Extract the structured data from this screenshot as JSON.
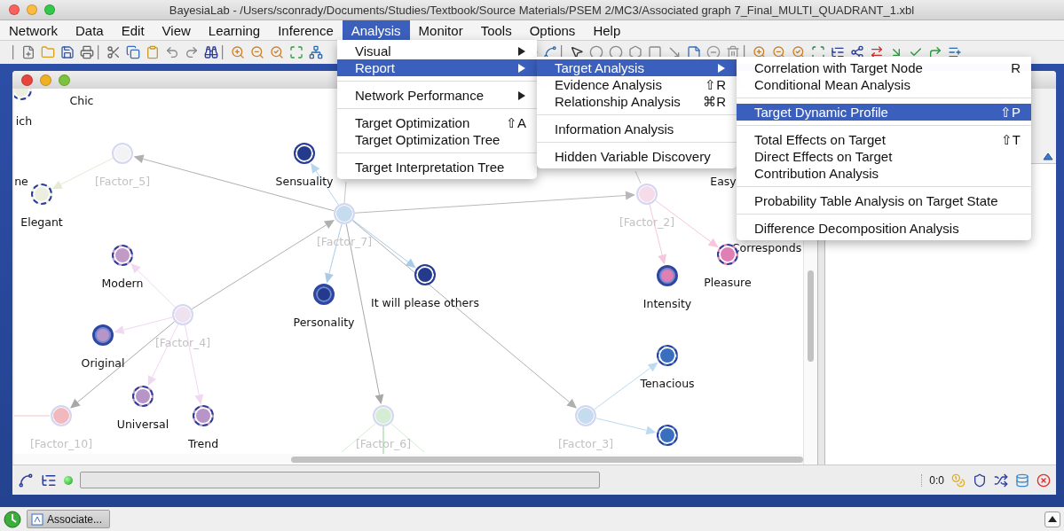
{
  "window": {
    "title": "BayesiaLab - /Users/sconrady/Documents/Studies/Textbook/Source Materials/PSEM 2/MC3/Associated graph 7_Final_MULTI_QUADRANT_1.xbl"
  },
  "menubar": [
    {
      "label": "Network",
      "selected": false
    },
    {
      "label": "Data",
      "selected": false
    },
    {
      "label": "Edit",
      "selected": false
    },
    {
      "label": "View",
      "selected": false
    },
    {
      "label": "Learning",
      "selected": false
    },
    {
      "label": "Inference",
      "selected": false
    },
    {
      "label": "Analysis",
      "selected": true
    },
    {
      "label": "Monitor",
      "selected": false
    },
    {
      "label": "Tools",
      "selected": false
    },
    {
      "label": "Options",
      "selected": false
    },
    {
      "label": "Help",
      "selected": false
    }
  ],
  "menus": [
    {
      "items": [
        {
          "kind": "item",
          "label": "Visual",
          "submenu": true,
          "selected": false
        },
        {
          "kind": "item",
          "label": "Report",
          "submenu": true,
          "selected": true
        },
        {
          "kind": "separator"
        },
        {
          "kind": "item",
          "label": "Network Performance",
          "submenu": true,
          "selected": false
        },
        {
          "kind": "separator"
        },
        {
          "kind": "item",
          "label": "Target Optimization",
          "shortcut": "⇧A",
          "submenu": false,
          "selected": false
        },
        {
          "kind": "item",
          "label": "Target Optimization Tree",
          "submenu": false,
          "selected": false
        },
        {
          "kind": "separator"
        },
        {
          "kind": "item",
          "label": "Target Interpretation Tree",
          "submenu": false,
          "selected": false
        }
      ]
    },
    {
      "items": [
        {
          "kind": "item",
          "label": "Target Analysis",
          "submenu": true,
          "selected": true
        },
        {
          "kind": "item",
          "label": "Evidence Analysis",
          "shortcut": "⇧R",
          "submenu": false,
          "selected": false
        },
        {
          "kind": "item",
          "label": "Relationship Analysis",
          "shortcut": "⌘R",
          "submenu": false,
          "selected": false
        },
        {
          "kind": "separator"
        },
        {
          "kind": "item",
          "label": "Information Analysis",
          "submenu": false,
          "selected": false
        },
        {
          "kind": "separator"
        },
        {
          "kind": "item",
          "label": "Hidden Variable Discovery",
          "submenu": false,
          "selected": false
        }
      ]
    },
    {
      "items": [
        {
          "kind": "item",
          "label": "Correlation with Target Node",
          "shortcut": "R",
          "submenu": false,
          "selected": false
        },
        {
          "kind": "item",
          "label": "Conditional Mean Analysis",
          "submenu": false,
          "selected": false
        },
        {
          "kind": "separator"
        },
        {
          "kind": "item",
          "label": "Target Dynamic Profile",
          "shortcut": "⇧P",
          "submenu": false,
          "selected": true
        },
        {
          "kind": "separator"
        },
        {
          "kind": "item",
          "label": "Total Effects on Target",
          "shortcut": "⇧T",
          "submenu": false,
          "selected": false
        },
        {
          "kind": "item",
          "label": "Direct Effects on Target",
          "submenu": false,
          "selected": false
        },
        {
          "kind": "item",
          "label": "Contribution Analysis",
          "submenu": false,
          "selected": false
        },
        {
          "kind": "separator"
        },
        {
          "kind": "item",
          "label": "Probability Table Analysis on Target State",
          "submenu": false,
          "selected": false
        },
        {
          "kind": "separator"
        },
        {
          "kind": "item",
          "label": "Difference Decomposition Analysis",
          "submenu": false,
          "selected": false
        }
      ]
    }
  ],
  "graph": {
    "nodes": [
      {
        "kind": "dashed",
        "color": "#ecefe0"
      },
      {
        "kind": "label",
        "label": "Chic"
      },
      {
        "kind": "label",
        "label": "ich"
      },
      {
        "kind": "label",
        "label": "ne"
      },
      {
        "kind": "factor",
        "color": "#f3f3f5",
        "label": "[Factor_5]"
      },
      {
        "kind": "dashed",
        "color": "#243a8c",
        "label": "Sensuality"
      },
      {
        "kind": "label",
        "label": "Easy"
      },
      {
        "kind": "dashed",
        "color": "#ecefe0",
        "label": "Elegant"
      },
      {
        "kind": "factor",
        "color": "#f6dce8",
        "label": "[Factor_2]"
      },
      {
        "kind": "factor",
        "color": "#c5dbee",
        "label": "[Factor_7]"
      },
      {
        "kind": "label",
        "label": "Corresponds"
      },
      {
        "kind": "dashed",
        "color": "#c29ac8",
        "label": "Modern"
      },
      {
        "kind": "dashed",
        "color": "#e07fb4",
        "label": "Pleasure"
      },
      {
        "kind": "dashed",
        "color": "#243a8c",
        "label": "It will please others"
      },
      {
        "kind": "solid",
        "color": "#e07fb4",
        "label": "Intensity"
      },
      {
        "kind": "solid",
        "color": "#243a8c",
        "label": "Personality"
      },
      {
        "kind": "factor",
        "color": "#efe2f0",
        "label": "[Factor_4]"
      },
      {
        "kind": "solid",
        "color": "#b895c8",
        "label": "Original"
      },
      {
        "kind": "dashed",
        "color": "#3a6fbf",
        "label": "Tenacious"
      },
      {
        "kind": "dashed",
        "color": "#b895c8",
        "label": "Universal"
      },
      {
        "kind": "factor",
        "color": "#f1b8be",
        "label": "[Factor_10]"
      },
      {
        "kind": "dashed",
        "color": "#b895c8",
        "label": "Trend"
      },
      {
        "kind": "factor",
        "color": "#d5ecd5",
        "label": "[Factor_6]"
      },
      {
        "kind": "factor",
        "color": "#c5dbee",
        "label": "[Factor_3]"
      },
      {
        "kind": "dashed",
        "color": "#3a6fbf"
      }
    ]
  },
  "status_bar": {
    "counter": "0:0",
    "progress": {
      "level": 0
    }
  },
  "taskbar": {
    "items": [
      {
        "label": "Associate..."
      }
    ]
  }
}
